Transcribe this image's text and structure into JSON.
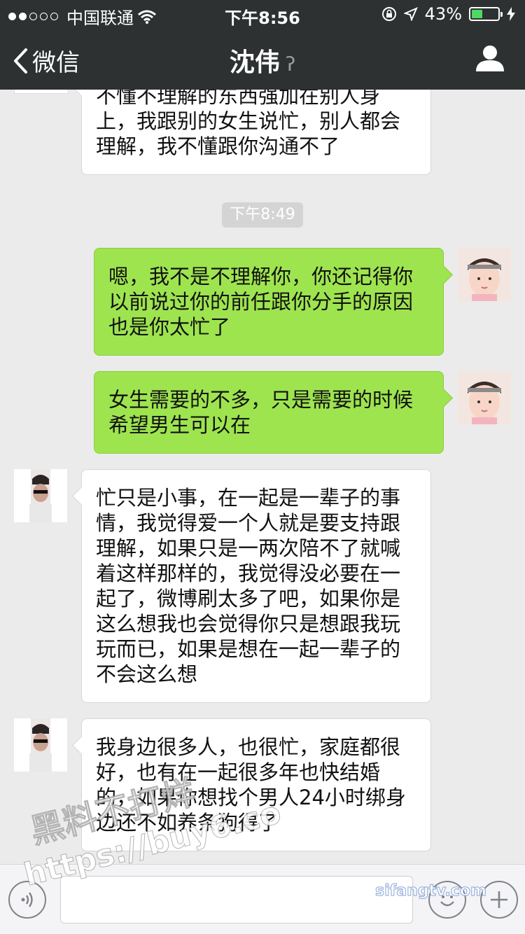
{
  "status": {
    "carrier": "中国联通",
    "time": "下午8:56",
    "battery": "43%",
    "battery_level": 0.43
  },
  "nav": {
    "back_label": "微信",
    "title": "沈伟"
  },
  "messages": [
    {
      "side": "in",
      "text": "不懂不理解的东西强加在别人身上，我跟别的女生说忙，别人都会理解，我不懂跟你沟通不了"
    },
    {
      "side": "out",
      "text": "嗯，我不是不理解你，你还记得你以前说过你的前任跟你分手的原因也是你太忙了"
    },
    {
      "side": "out",
      "text": "女生需要的不多，只是需要的时候希望男生可以在"
    },
    {
      "side": "in",
      "text": "忙只是小事，在一起是一辈子的事情，我觉得爱一个人就是要支持跟理解，如果只是一两次陪不了就喊着这样那样的，我觉得没必要在一起了，微博刷太多了吧，如果你是这么想我也会觉得你只是想跟我玩玩而已，如果是想在一起一辈子的不会这么想"
    },
    {
      "side": "in",
      "text": "我身边很多人，也很忙，家庭都很好，也有在一起很多年也快结婚的，如果你想找个男人24小时绑身边还不如养条狗得了"
    }
  ],
  "timestamp": "下午8:49",
  "watermarks": {
    "w1": "黑料不打烊",
    "w2": "https://buy6.co",
    "w3": "sifangtv.com"
  },
  "colors": {
    "nav_bg": "#2e3132",
    "chat_bg": "#ebebeb",
    "out_bubble": "#9ee44f",
    "in_bubble": "#ffffff"
  }
}
